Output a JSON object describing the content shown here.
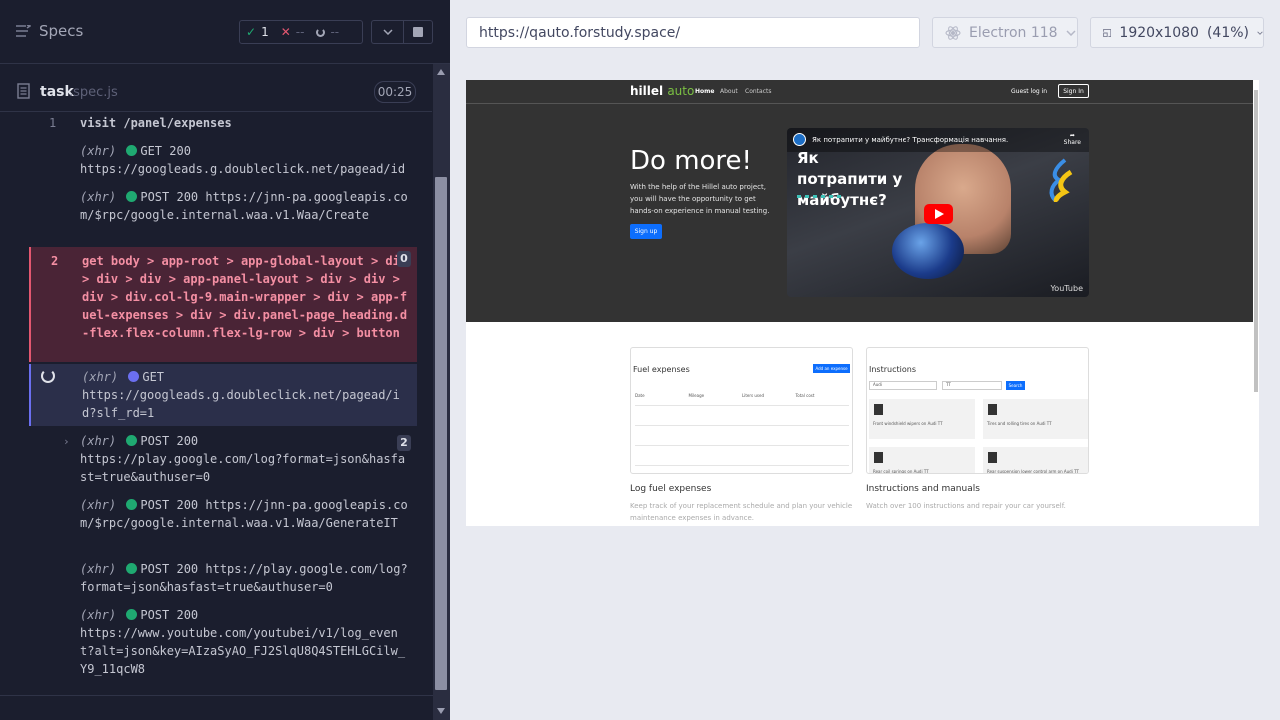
{
  "topbar": {
    "specs_label": "Specs",
    "passed": "1",
    "failed": "--",
    "pending": "--"
  },
  "spec": {
    "name": "task",
    "ext": ".spec.js",
    "timer": "00:25"
  },
  "log": {
    "r0_num": "1",
    "r0_text": "visit  /panel/expenses",
    "r1_kind": "(xhr)",
    "r1_text": "GET 200",
    "r1_url": "https://googleads.g.doubleclick.net/pagead/id",
    "r2_kind": "(xhr)",
    "r2_text": "POST 200 https://jnn-pa.googleapis.com/$rpc/google.internal.waa.v1.Waa/Create",
    "r3_num": "2",
    "r3_text": "get  body > app-root > app-global-layout > div > div > div > app-panel-layout > div > div > div > div.col-lg-9.main-wrapper > div > app-fuel-expenses > div > div.panel-page_heading.d-flex.flex-column.flex-lg-row > div > button",
    "r3_badge": "0",
    "r4_kind": "(xhr)",
    "r4_text": "GET",
    "r4_url": "https://googleads.g.doubleclick.net/pagead/id?slf_rd=1",
    "r5_kind": "(xhr)",
    "r5_text": "POST 200",
    "r5_url": "https://play.google.com/log?format=json&hasfast=true&authuser=0",
    "r5_badge": "2",
    "r6_kind": "(xhr)",
    "r6_text": "POST 200 https://jnn-pa.googleapis.com/$rpc/google.internal.waa.v1.Waa/GenerateIT",
    "r7_kind": "(xhr)",
    "r7_text": "POST 200 https://play.google.com/log?format=json&hasfast=true&authuser=0",
    "r8_kind": "(xhr)",
    "r8_text": "POST 200",
    "r8_url": "https://www.youtube.com/youtubei/v1/log_event?alt=json&key=AIzaSyAO_FJ2SlqU8Q4STEHLGCilw_Y9_11qcW8"
  },
  "browser": {
    "url": "https://qauto.forstudy.space/",
    "engine": "Electron 118",
    "viewport": "1920x1080",
    "scale": "(41%)"
  },
  "site": {
    "logo_main": "hillel",
    "logo_accent": "auto",
    "nav_home": "Home",
    "nav_about": "About",
    "nav_contacts": "Contacts",
    "guest": "Guest log in",
    "signin": "Sign In",
    "hero_title": "Do more!",
    "hero_text": "With the help of the Hillel auto project, you will have the opportunity to get hands-on experience in manual testing.",
    "signup": "Sign up",
    "video_title": "Як потрапити у майбутнє? Трансформація навчання.",
    "video_big": "Як потрапити у майбутнє?",
    "video_share": "Share",
    "video_youtube": "YouTube",
    "card1_title": "Fuel expenses",
    "card1_button": "Add an expense",
    "card1_cols": [
      "Date",
      "Mileage",
      "Liters used",
      "Total cost"
    ],
    "card2_title": "Instructions",
    "card2_sel1": "Audi",
    "card2_sel2": "TT",
    "card2_search": "Search",
    "tile1": "Front windshield wipers on Audi TT",
    "tile2": "Tires and rolling tires on Audi TT",
    "tile3": "Rear coil springs on Audi TT",
    "tile4": "Rear suspension lower control arm on Audi TT",
    "feat1_title": "Log fuel expenses",
    "feat1_text": "Keep track of your replacement schedule and plan your vehicle maintenance expenses in advance.",
    "feat2_title": "Instructions and manuals",
    "feat2_text": "Watch over 100 instructions and repair your car yourself."
  },
  "colors": {
    "passed": "#1fa971",
    "failed": "#e45770",
    "accent": "#6b6ff0",
    "brand_green": "#7bc043",
    "bootstrap_blue": "#0d6efd"
  }
}
